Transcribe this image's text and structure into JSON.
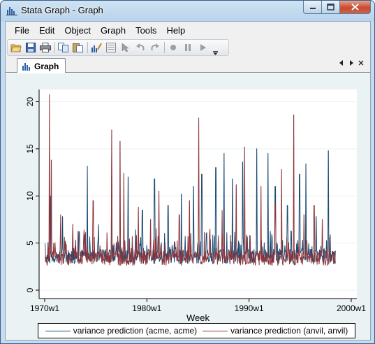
{
  "window": {
    "title": "Stata Graph - Graph",
    "minimize_icon": "minimize-icon",
    "maximize_icon": "maximize-icon",
    "close_icon": "close-icon"
  },
  "menu": [
    "File",
    "Edit",
    "Object",
    "Graph",
    "Tools",
    "Help"
  ],
  "toolbar": {
    "buttons": [
      "open-icon",
      "save-icon",
      "print-icon",
      "copy-icon",
      "paste-icon",
      "graph-editor-icon",
      "object-browser-icon",
      "pointer-icon",
      "undo-icon",
      "redo-icon",
      "record-icon",
      "pause-icon",
      "play-icon"
    ],
    "overflow_icon": "toolbar-overflow-icon"
  },
  "tabs": [
    {
      "label": "Graph",
      "icon": "graph-icon"
    }
  ],
  "tab_nav": {
    "left_icon": "triangle-left-icon",
    "right_icon": "triangle-right-icon"
  },
  "colors": {
    "series1": "#1a4a72",
    "series2": "#90353b",
    "plot_bg": "#ffffff",
    "graph_bg": "#eaf2f3"
  },
  "chart_data": {
    "type": "line",
    "title": "",
    "xlabel": "Week",
    "ylabel": "",
    "x_range": [
      "1970w1",
      "2000w1"
    ],
    "x_ticks": [
      "1970w1",
      "1980w1",
      "1990w1",
      "2000w1"
    ],
    "ylim": [
      0,
      21
    ],
    "y_ticks": [
      "0",
      "5",
      "10",
      "15",
      "20"
    ],
    "grid": true,
    "legend": "bottom",
    "series": [
      {
        "name": "variance prediction (acme, acme)",
        "baseline": 2.8,
        "peaks": [
          {
            "x": "1970w30",
            "y": 10.0
          },
          {
            "x": "1971w40",
            "y": 7.8
          },
          {
            "x": "1973w20",
            "y": 6.2
          },
          {
            "x": "1974w10",
            "y": 13.2
          },
          {
            "x": "1975w15",
            "y": 7.0
          },
          {
            "x": "1976w30",
            "y": 14.0
          },
          {
            "x": "1978w10",
            "y": 12.0
          },
          {
            "x": "1979w30",
            "y": 8.5
          },
          {
            "x": "1980w40",
            "y": 11.8
          },
          {
            "x": "1982w5",
            "y": 9.0
          },
          {
            "x": "1983w20",
            "y": 10.2
          },
          {
            "x": "1984w30",
            "y": 11.0
          },
          {
            "x": "1985w20",
            "y": 12.3
          },
          {
            "x": "1986w40",
            "y": 13.0
          },
          {
            "x": "1987w30",
            "y": 14.5
          },
          {
            "x": "1988w20",
            "y": 11.8
          },
          {
            "x": "1989w20",
            "y": 13.6
          },
          {
            "x": "1990w40",
            "y": 15.0
          },
          {
            "x": "1991w45",
            "y": 14.5
          },
          {
            "x": "1992w30",
            "y": 11.0
          },
          {
            "x": "1993w40",
            "y": 9.0
          },
          {
            "x": "1994w50",
            "y": 12.3
          },
          {
            "x": "1995w30",
            "y": 13.4
          },
          {
            "x": "1996w30",
            "y": 7.8
          },
          {
            "x": "1997w40",
            "y": 14.8
          }
        ]
      },
      {
        "name": "variance prediction (anvil, anvil)",
        "baseline": 2.6,
        "peaks": [
          {
            "x": "1970w25",
            "y": 20.8
          },
          {
            "x": "1970w35",
            "y": 13.8
          },
          {
            "x": "1971w30",
            "y": 8.0
          },
          {
            "x": "1972w40",
            "y": 7.0
          },
          {
            "x": "1974w40",
            "y": 9.5
          },
          {
            "x": "1976w30",
            "y": 17.0
          },
          {
            "x": "1977w20",
            "y": 15.8
          },
          {
            "x": "1977w40",
            "y": 12.4
          },
          {
            "x": "1979w10",
            "y": 8.8
          },
          {
            "x": "1980w20",
            "y": 7.5
          },
          {
            "x": "1981w10",
            "y": 10.5
          },
          {
            "x": "1983w10",
            "y": 8.0
          },
          {
            "x": "1984w10",
            "y": 9.5
          },
          {
            "x": "1985w5",
            "y": 18.3
          },
          {
            "x": "1986w10",
            "y": 6.5
          },
          {
            "x": "1987w20",
            "y": 8.5
          },
          {
            "x": "1988w40",
            "y": 11.2
          },
          {
            "x": "1989w30",
            "y": 15.2
          },
          {
            "x": "1991w10",
            "y": 11.0
          },
          {
            "x": "1992w30",
            "y": 9.2
          },
          {
            "x": "1993w10",
            "y": 12.8
          },
          {
            "x": "1994w20",
            "y": 18.6
          },
          {
            "x": "1995w20",
            "y": 8.0
          },
          {
            "x": "1996w20",
            "y": 9.0
          },
          {
            "x": "1997w10",
            "y": 7.5
          }
        ]
      }
    ]
  }
}
